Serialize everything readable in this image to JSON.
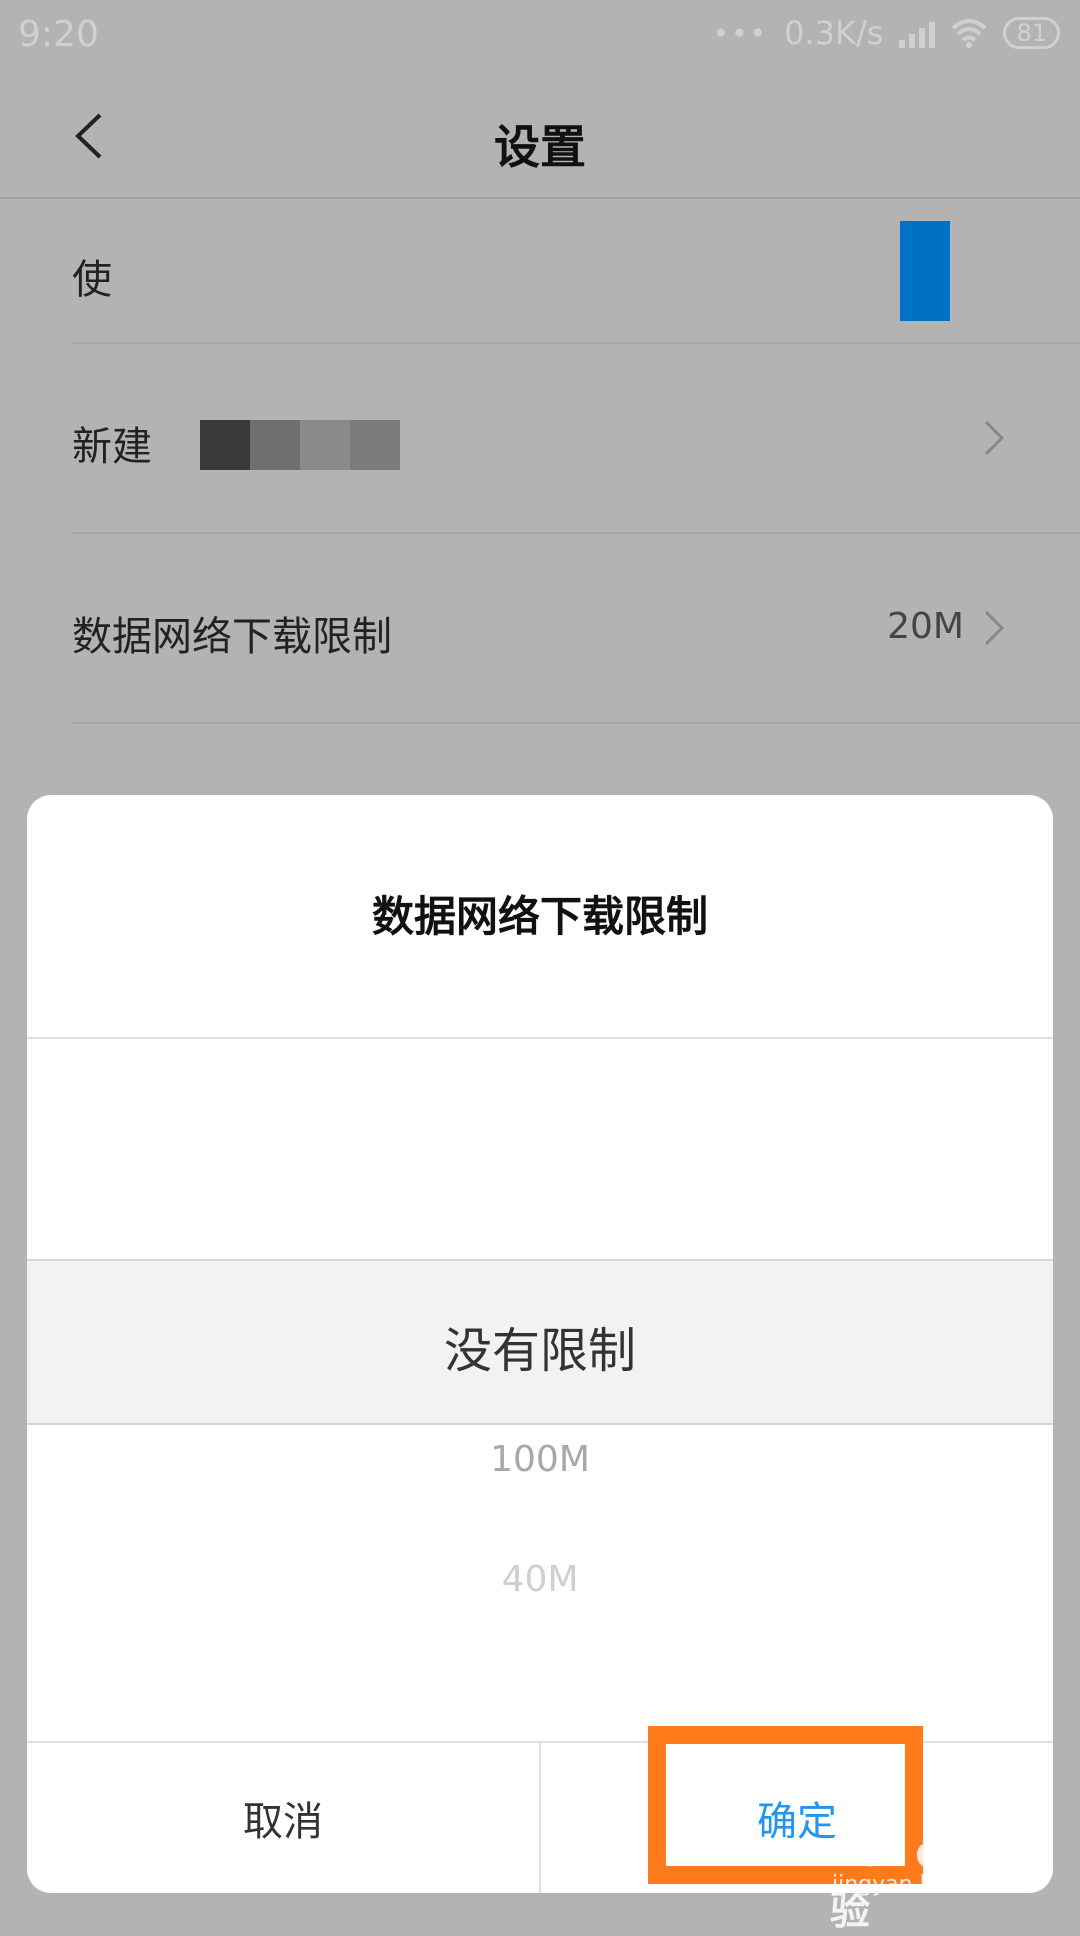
{
  "status_bar": {
    "time": "9:20",
    "dots": "•••",
    "net_speed": "0.3K/s",
    "battery": "81"
  },
  "header": {
    "title": "设置"
  },
  "rows": [
    {
      "label": "使"
    },
    {
      "label": "新建"
    },
    {
      "label": "数据网络下载限制",
      "value": "20M"
    }
  ],
  "dialog": {
    "title": "数据网络下载限制",
    "selected_option": "没有限制",
    "options_below": [
      "100M",
      "40M"
    ],
    "cancel_label": "取消",
    "confirm_label": "确定"
  },
  "watermark": {
    "main": "Bai du 经验",
    "sub": "jingyan.baidu.com"
  },
  "colors": {
    "accent": "#2196f3",
    "highlight": "#ff7a1a",
    "toggle": "#0072c6"
  }
}
